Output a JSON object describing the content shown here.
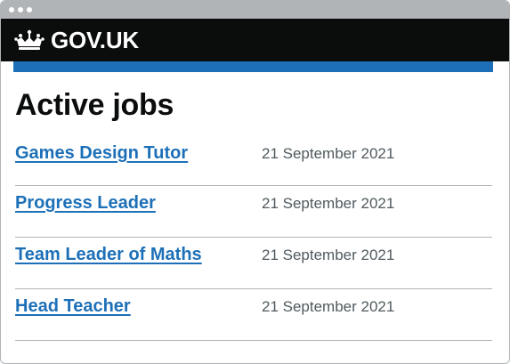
{
  "header": {
    "logo_text": "GOV.UK",
    "logo_icon": "crown-icon"
  },
  "main": {
    "title": "Active jobs",
    "jobs": [
      {
        "title": "Games Design Tutor",
        "date": "21 September 2021"
      },
      {
        "title": "Progress Leader",
        "date": "21 September 2021"
      },
      {
        "title": "Team Leader of Maths",
        "date": "21 September 2021"
      },
      {
        "title": "Head Teacher",
        "date": "21 September 2021"
      }
    ]
  },
  "colors": {
    "header_background": "#0b0c0c",
    "brand_blue": "#1d70b8",
    "link": "#1d70b8",
    "secondary_text": "#505a5f",
    "border": "#b1b4b6"
  }
}
